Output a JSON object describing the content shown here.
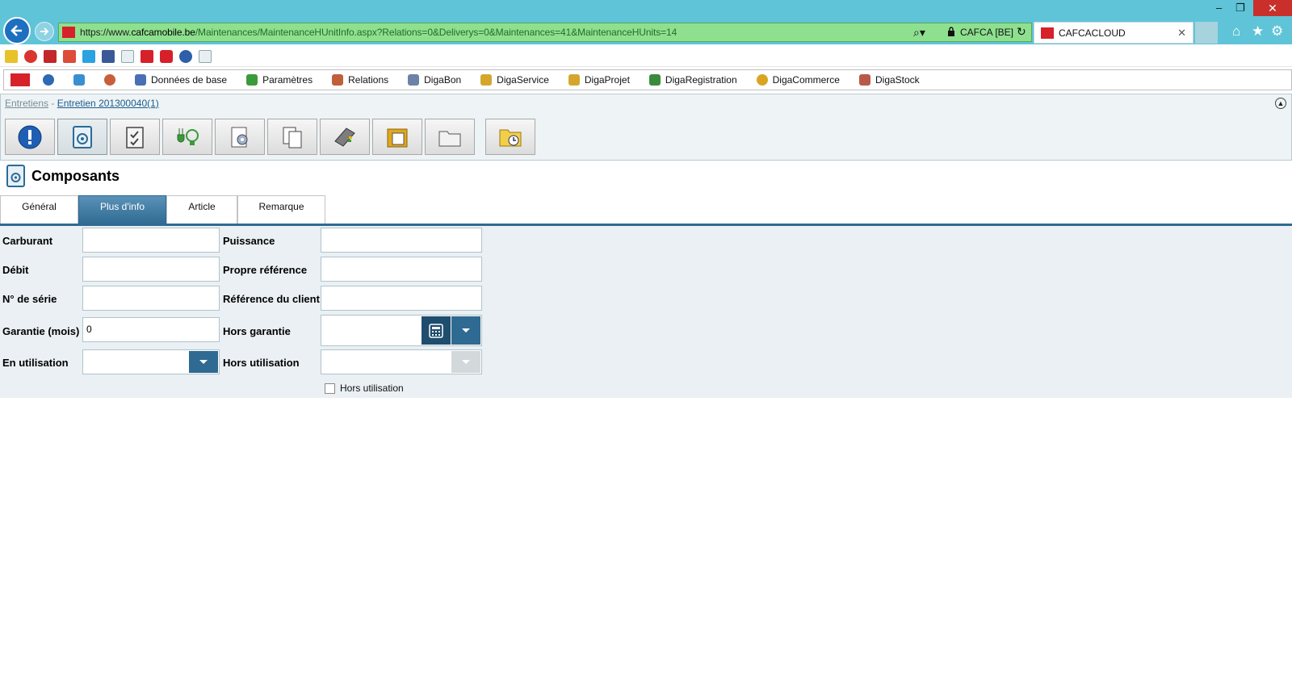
{
  "browser": {
    "url": {
      "scheme": "https://www.",
      "domain": "cafcamobile.be",
      "path": "/Maintenances/MaintenanceHUnitInfo.aspx?Relations=0&Deliverys=0&Maintenances=41&MaintenanceHUnits=14"
    },
    "site_identity": "CAFCA [BE]",
    "tab_title": "CAFCACLOUD",
    "tab_close": "✕",
    "window_controls": {
      "minimize": "–",
      "restore": "❐",
      "close": "✕"
    },
    "toolbar_icons": [
      "home-icon",
      "star-icon",
      "gear-icon"
    ],
    "favorites_icons": [
      "favorites-star-icon",
      "ie-icon",
      "cafca-icon",
      "google-plus-icon",
      "twitter-icon",
      "facebook-icon",
      "ie-page-icon",
      "cafca-red-icon",
      "cafca-c-icon",
      "globe-icon",
      "ie-blank-icon"
    ]
  },
  "app_menu": {
    "logo": "CAFCA",
    "items": [
      {
        "label": "Données de base",
        "icon": "database-icon",
        "color": "#4a6fb5"
      },
      {
        "label": "Paramètres",
        "icon": "settings-icon",
        "color": "#3b9b3b"
      },
      {
        "label": "Relations",
        "icon": "users-icon",
        "color": "#c0603a"
      },
      {
        "label": "DigaBon",
        "icon": "document-icon",
        "color": "#6c82a6"
      },
      {
        "label": "DigaService",
        "icon": "service-icon",
        "color": "#d4a72c"
      },
      {
        "label": "DigaProjet",
        "icon": "project-icon",
        "color": "#d4a72c"
      },
      {
        "label": "DigaRegistration",
        "icon": "registration-icon",
        "color": "#3b8b3b"
      },
      {
        "label": "DigaCommerce",
        "icon": "commerce-icon",
        "color": "#d9a521"
      },
      {
        "label": "DigaStock",
        "icon": "stock-icon",
        "color": "#b85a4a"
      }
    ]
  },
  "breadcrumb": {
    "root": "Entretiens",
    "separator": " - ",
    "current": "Entretien 201300040(1)"
  },
  "toolbar_buttons": [
    "info-icon",
    "component-icon",
    "checklist-icon",
    "plug-bulb-icon",
    "config-document-icon",
    "copy-document-icon",
    "notebook-icon",
    "folder-document-icon",
    "folder-icon",
    "folder-clock-icon"
  ],
  "page": {
    "title": "Composants"
  },
  "tabs": [
    {
      "label": "Général",
      "selected": false
    },
    {
      "label": "Plus d'info",
      "selected": true
    },
    {
      "label": "Article",
      "selected": false
    },
    {
      "label": "Remarque",
      "selected": false
    }
  ],
  "form": {
    "carburant": {
      "label": "Carburant",
      "value": ""
    },
    "puissance": {
      "label": "Puissance",
      "value": ""
    },
    "debit": {
      "label": "Débit",
      "value": ""
    },
    "propre_reference": {
      "label": "Propre référence",
      "value": ""
    },
    "numero_serie": {
      "label": "N° de série",
      "value": ""
    },
    "reference_client": {
      "label": "Référence du client",
      "value": ""
    },
    "garantie": {
      "label": "Garantie (mois)",
      "value": "0"
    },
    "hors_garantie": {
      "label": "Hors garantie",
      "value": ""
    },
    "en_utilisation": {
      "label": "En utilisation",
      "value": ""
    },
    "hors_utilisation": {
      "label": "Hors utilisation",
      "value": ""
    },
    "hors_utilisation_checkbox": {
      "label": "Hors utilisation",
      "checked": false
    }
  },
  "colors": {
    "chrome": "#5fc4d8",
    "address_bar": "#8ee08f",
    "accent": "#2f6a92",
    "form_bg": "#eaf0f3"
  }
}
